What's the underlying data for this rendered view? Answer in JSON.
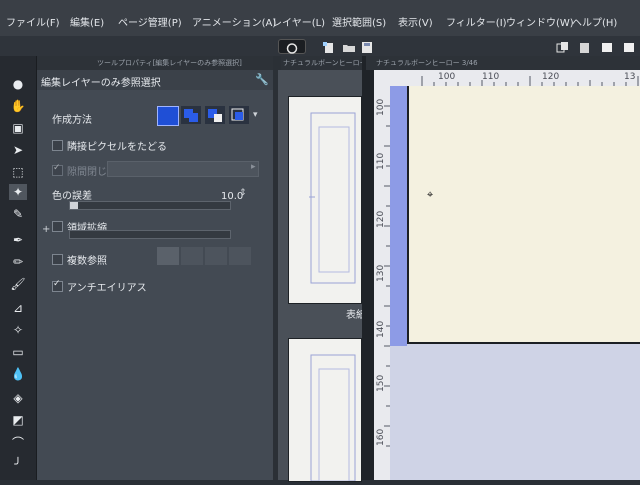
{
  "menu": {
    "items": [
      "ファイル(F)",
      "編集(E)",
      "ページ管理(P)",
      "アニメーション(A)",
      "レイヤー(L)",
      "選択範囲(S)",
      "表示(V)",
      "フィルター(I)",
      "ウィンドウ(W)",
      "ヘルプ(H)"
    ]
  },
  "tool_property": {
    "tab_label": "ツールプロパティ[編集レイヤーのみ参照選択]",
    "title": "編集レイヤーのみ参照選択",
    "creation_method_label": "作成方法",
    "trace_adjacent_label": "隣接ピクセルをたどる",
    "close_gap_label": "隙間閉じ",
    "color_margin_label": "色の誤差",
    "color_margin_value": "10.0",
    "color_margin_level": 0.05,
    "expand_area_label": "領域拡縮",
    "multi_reference_label": "複数参照",
    "antialias_label": "アンチエイリアス",
    "antialias_checked": true,
    "close_gap_checked": true
  },
  "navigator": {
    "tab_label": "ナチュラルボーンヒーロー",
    "thumb_label": "表紙"
  },
  "canvas": {
    "tab_label": "ナチュラルボーンヒーロー 3/46",
    "ruler_top": [
      "100",
      "110",
      "120",
      "13"
    ],
    "ruler_left": [
      "100",
      "110",
      "120",
      "130",
      "140",
      "150",
      "160"
    ]
  },
  "colors": {
    "paper": "#f4f1e0",
    "canvas_accent": "#8d9be6",
    "creation_button_blue": "#1f4fd6"
  }
}
